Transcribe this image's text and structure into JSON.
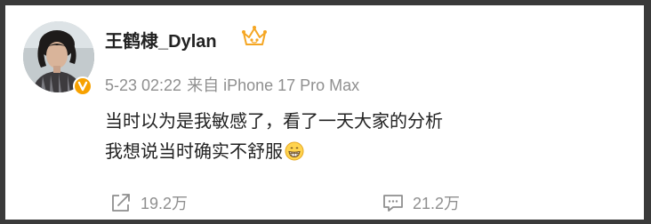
{
  "post": {
    "author": {
      "name": "王鹤棣_Dylan",
      "avatar_icon": "avatar-photo",
      "verified_icon": "verified-badge-icon",
      "crown_icon": "crown-icon"
    },
    "meta": {
      "time": "5-23 02:22",
      "source": "来自 iPhone 17 Pro Max"
    },
    "content": {
      "line1": "当时以为是我敏感了，看了一天大家的分析",
      "line2": "我想说当时确实不舒服",
      "emoji": "grinning-emoji"
    },
    "actions": {
      "repost_count": "19.2万",
      "comment_count": "21.2万",
      "repost_icon": "share-icon",
      "comment_icon": "comment-icon"
    }
  },
  "colors": {
    "text_primary": "#222222",
    "text_secondary": "#8f8f8f",
    "verified_badge": "#f7a100",
    "crown": "#f5a623"
  }
}
